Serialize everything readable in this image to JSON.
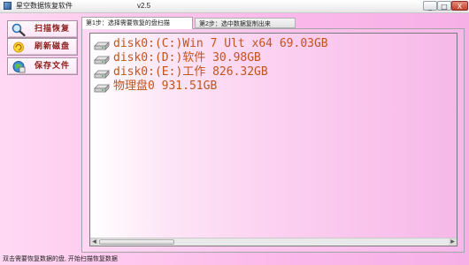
{
  "window": {
    "title": "星空数据恢复软件",
    "version": "v2.5",
    "controls": {
      "minimize": "_",
      "maximize": "□",
      "close": "X"
    }
  },
  "sidebar": {
    "buttons": [
      {
        "label": "扫描恢复",
        "icon": "magnifier-icon"
      },
      {
        "label": "刷新磁盘",
        "icon": "sun-refresh-icon"
      },
      {
        "label": "保存文件",
        "icon": "save-globe-icon"
      }
    ]
  },
  "tabs": [
    {
      "label": "第1步：选择需要恢复的盘扫描",
      "active": true
    },
    {
      "label": "第2步：选中数据复制出来",
      "active": false
    }
  ],
  "disks": [
    {
      "label": "disk0:(C:)Win 7 Ult x64 69.03GB",
      "icon": "drive-icon"
    },
    {
      "label": "disk0:(D:)软件 30.98GB",
      "icon": "drive-icon"
    },
    {
      "label": "disk0:(E:)工作 826.32GB",
      "icon": "drive-icon"
    },
    {
      "label": "物理盘0 931.51GB",
      "icon": "drive-icon"
    }
  ],
  "scrollbar": {
    "left": "◀",
    "right": "▶"
  },
  "status": {
    "text": "双击需要恢复数据的盘, 开始扫描恢复数据"
  },
  "colors": {
    "disk_text": "#c0541c",
    "button_text": "#8a1a16",
    "background": "#fbc8ee"
  }
}
